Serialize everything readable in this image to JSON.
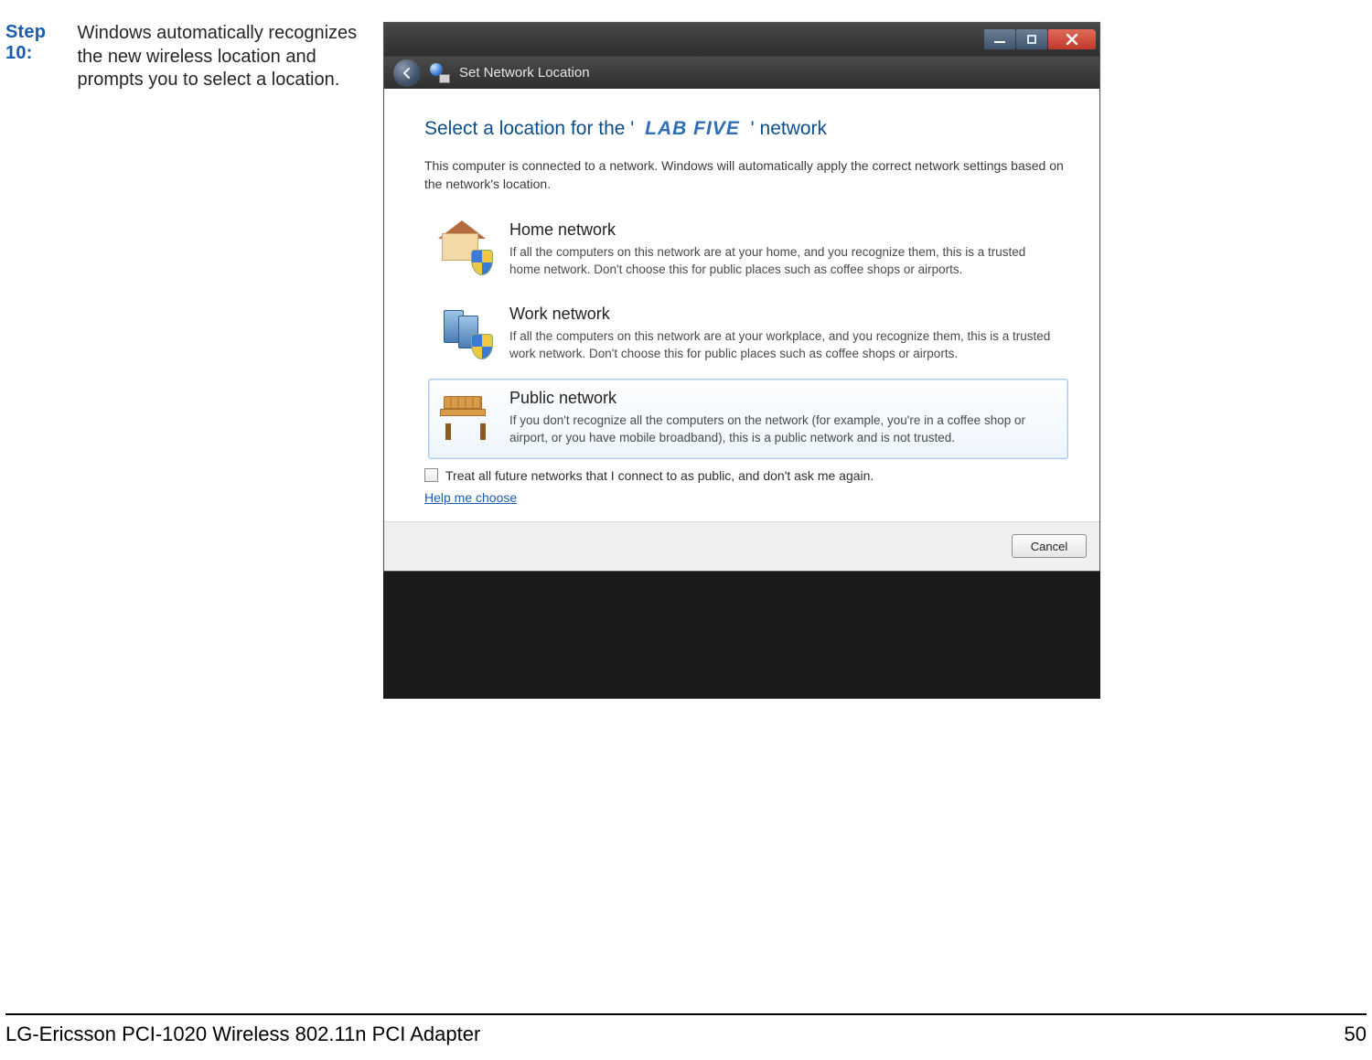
{
  "step": {
    "label": "Step 10:",
    "text": "Windows automatically recognizes the new wireless location and prompts you to select a location."
  },
  "footer": {
    "product": "LG-Ericsson PCI-1020 Wireless 802.11n PCI Adapter",
    "page": "50"
  },
  "dialog": {
    "titlebar": {
      "min_icon": "minimize-icon",
      "max_icon": "maximize-icon",
      "close_icon": "close-icon"
    },
    "subbar": {
      "back_icon": "back-arrow-icon",
      "app_icon": "network-location-icon",
      "title": "Set Network Location"
    },
    "heading_prefix": "Select a location for the '",
    "heading_network": "LAB FIVE",
    "heading_suffix": "' network",
    "intro": "This computer is connected to a network. Windows will automatically apply the correct network settings based on the network's location.",
    "options": [
      {
        "title": "Home network",
        "desc": "If all the computers on this network are at your home, and you recognize them, this is a trusted home network.  Don't choose this for public places such as coffee shops or airports.",
        "selected": false
      },
      {
        "title": "Work network",
        "desc": "If all the computers on this network are at your workplace, and you recognize them, this is a trusted work network.  Don't choose this for public places such as coffee shops or airports.",
        "selected": false
      },
      {
        "title": "Public network",
        "desc": "If you don't recognize all the computers on the network (for example, you're in a coffee shop or airport, or you have mobile broadband), this is a public network and is not trusted.",
        "selected": true
      }
    ],
    "future_checkbox": {
      "checked": false,
      "label": "Treat all future networks that I connect to as public, and don't ask me again."
    },
    "help_link": "Help me choose",
    "buttons": {
      "cancel": "Cancel"
    }
  }
}
